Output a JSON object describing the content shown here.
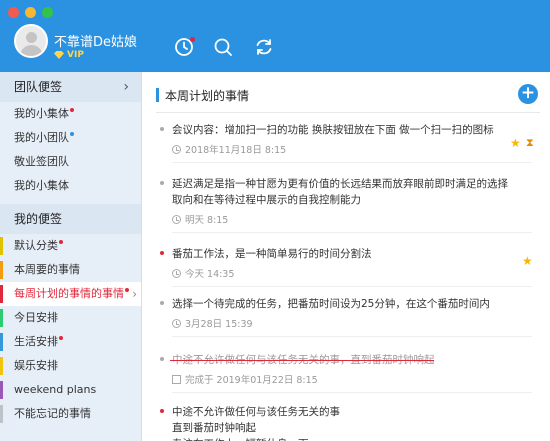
{
  "header": {
    "username": "不靠谱De姑娘",
    "vip_label": "VIP",
    "accent_color": "#2a92e0",
    "icons": [
      "clock-icon",
      "search-icon",
      "sync-icon"
    ]
  },
  "sidebar": {
    "team_section": {
      "title": "团队便签",
      "items": [
        {
          "label": "我的小集体",
          "dot": "red"
        },
        {
          "label": "我的小团队",
          "dot": "blue"
        },
        {
          "label": "敬业签团队",
          "dot": ""
        },
        {
          "label": "我的小集体",
          "dot": ""
        }
      ]
    },
    "my_section": {
      "title": "我的便签",
      "items": [
        {
          "label": "默认分类",
          "dot": "red",
          "bar_color": "#e0c200"
        },
        {
          "label": "本周要的事情",
          "dot": "",
          "bar_color": "#f39c12"
        },
        {
          "label": "每周计划的事情的事情",
          "dot": "red",
          "bar_color": "#e0283c",
          "active": true
        },
        {
          "label": "今日安排",
          "dot": "",
          "bar_color": "#2ecc71"
        },
        {
          "label": "生活安排",
          "dot": "red",
          "bar_color": "#3498db"
        },
        {
          "label": "娱乐安排",
          "dot": "",
          "bar_color": "#f1c40f"
        },
        {
          "label": "weekend plans",
          "dot": "",
          "bar_color": "#9b59b6"
        },
        {
          "label": "不能忘记的事情",
          "dot": "",
          "bar_color": "#bdc3c7"
        }
      ]
    }
  },
  "main": {
    "title": "本周计划的事情",
    "tasks": [
      {
        "text": "会议内容：增加扫一扫的功能  换肤按钮放在下面  做一个扫一扫的图标",
        "meta": "2018年11月18日 8:15",
        "dot_color": "#aaaaaa",
        "starred": true,
        "hourglass": true,
        "done": false
      },
      {
        "text": "延迟满足是指一种甘愿为更有价值的长远结果而放弃眼前即时满足的选择取向和在等待过程中展示的自我控制能力",
        "meta": "明天 8:15",
        "dot_color": "#aaaaaa",
        "starred": false,
        "hourglass": false,
        "done": false
      },
      {
        "text": "番茄工作法，是一种简单易行的时间分割法",
        "meta": "今天 14:35",
        "dot_color": "#e0283c",
        "starred": true,
        "hourglass": false,
        "done": false
      },
      {
        "text": "选择一个待完成的任务，把番茄时间设为25分钟，在这个番茄时间内",
        "meta": "3月28日 15:39",
        "dot_color": "#aaaaaa",
        "starred": false,
        "hourglass": false,
        "done": false
      },
      {
        "text": "中途不允许做任何与该任务无关的事，直到番茄时钟响起",
        "meta": "完成于 2019年01月22日 8:15",
        "dot_color": "#aaaaaa",
        "starred": false,
        "hourglass": false,
        "done": true
      },
      {
        "text": "中途不允许做任何与该任务无关的事\n直到番茄时钟响起\n专注在工作上，短暂休息一下",
        "meta": "",
        "dot_color": "#e0283c",
        "starred": false,
        "hourglass": false,
        "done": false
      }
    ]
  }
}
